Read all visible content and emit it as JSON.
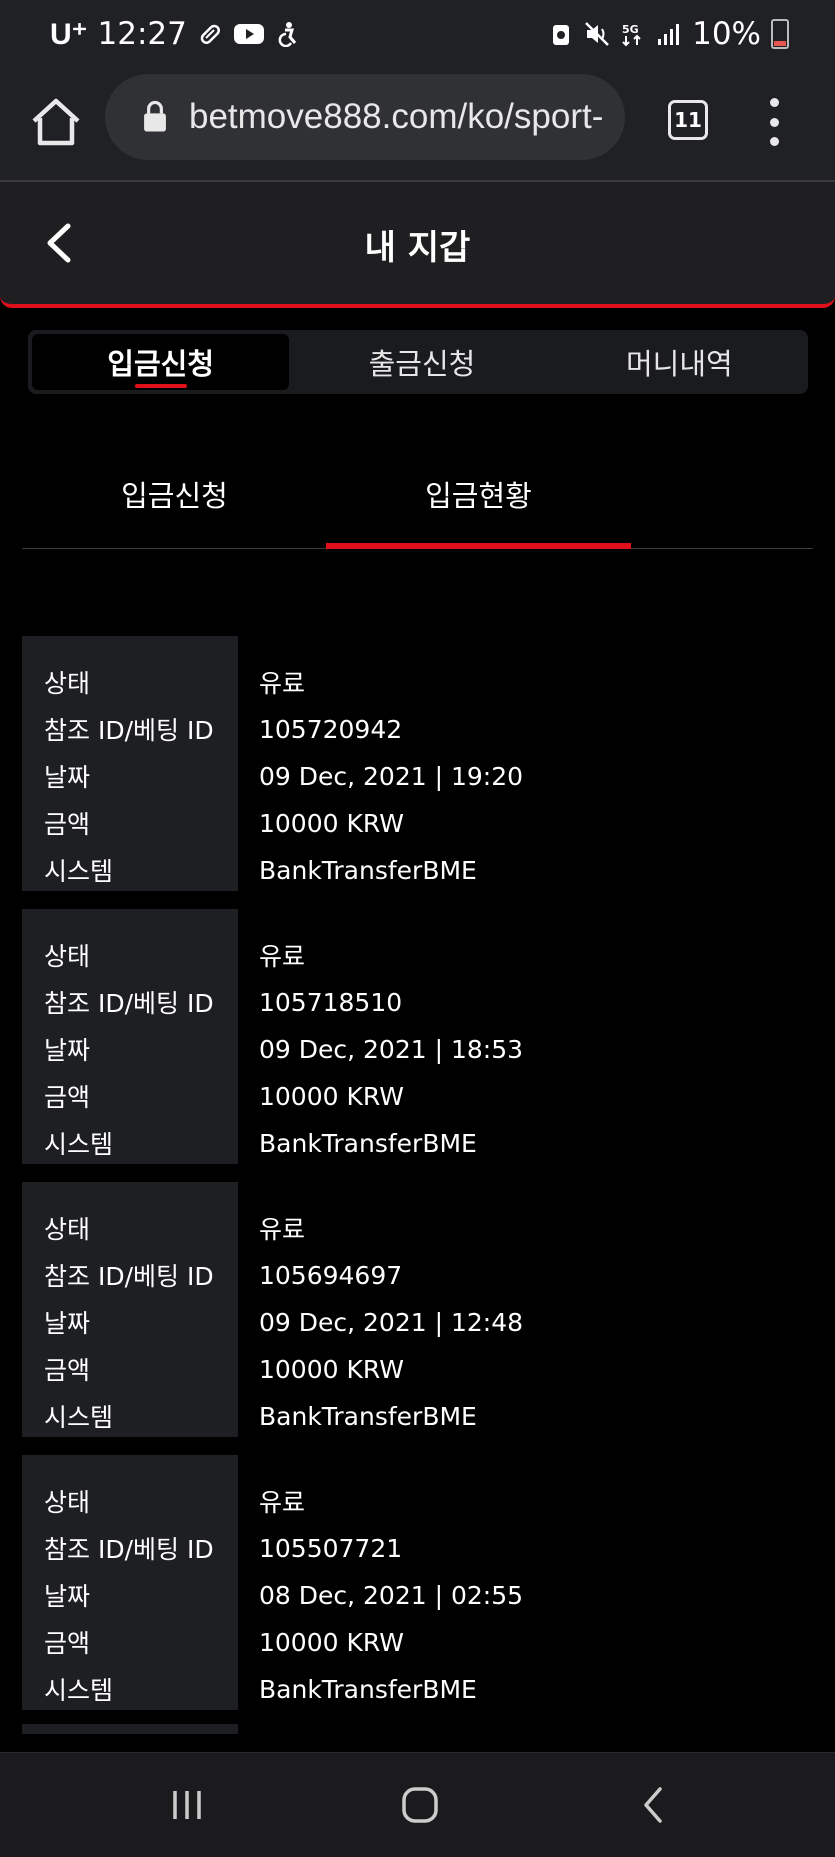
{
  "status_bar": {
    "carrier": "U⁺",
    "time": "12:27",
    "battery": "10%",
    "left_icons": [
      "pill-icon",
      "youtube-icon",
      "accessibility-icon"
    ],
    "right_icons": [
      "recycle-icon",
      "mute-icon",
      "5g-icon",
      "signal-icon",
      "battery-icon"
    ]
  },
  "browser": {
    "url": "betmove888.com/ko/sport-",
    "tab_count": "11"
  },
  "header": {
    "title": "내 지갑"
  },
  "main_tabs": [
    {
      "label": "입금신청",
      "active": true
    },
    {
      "label": "출금신청",
      "active": false
    },
    {
      "label": "머니내역",
      "active": false
    }
  ],
  "sub_tabs": [
    {
      "label": "입금신청",
      "active": false
    },
    {
      "label": "입금현황",
      "active": true
    }
  ],
  "field_labels": {
    "status": "상태",
    "ref_id": "참조 ID/베팅 ID",
    "date": "날짜",
    "amount": "금액",
    "system": "시스템"
  },
  "records": [
    {
      "status": "유료",
      "ref_id": "105720942",
      "date": "09 Dec, 2021 | 19:20",
      "amount": "10000 KRW",
      "system": "BankTransferBME"
    },
    {
      "status": "유료",
      "ref_id": "105718510",
      "date": "09 Dec, 2021 | 18:53",
      "amount": "10000 KRW",
      "system": "BankTransferBME"
    },
    {
      "status": "유료",
      "ref_id": "105694697",
      "date": "09 Dec, 2021 | 12:48",
      "amount": "10000 KRW",
      "system": "BankTransferBME"
    },
    {
      "status": "유료",
      "ref_id": "105507721",
      "date": "08 Dec, 2021 | 02:55",
      "amount": "10000 KRW",
      "system": "BankTransferBME"
    }
  ],
  "colors": {
    "accent": "#e0101b",
    "background": "#000000",
    "panel": "#1e1f23"
  }
}
